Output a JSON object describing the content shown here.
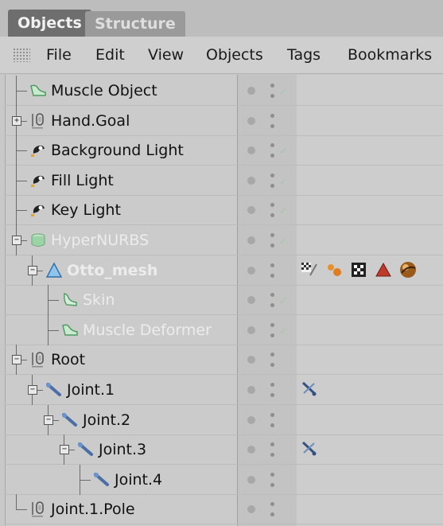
{
  "tabs": [
    {
      "label": "Objects"
    },
    {
      "label": "Structure"
    }
  ],
  "menu": [
    "File",
    "Edit",
    "View",
    "Objects",
    "Tags",
    "Bookmarks"
  ],
  "rows": [
    {
      "label": "Muscle Object",
      "icon": "muscle-object-icon",
      "depth": 0,
      "expander": null,
      "dim": false,
      "bold": false,
      "check": true,
      "tags": []
    },
    {
      "label": "Hand.Goal",
      "icon": "null-object-icon",
      "depth": 0,
      "expander": "+",
      "dim": false,
      "bold": false,
      "check": false,
      "tags": []
    },
    {
      "label": "Background Light",
      "icon": "light-icon",
      "depth": 0,
      "expander": null,
      "dim": false,
      "bold": false,
      "check": true,
      "tags": []
    },
    {
      "label": "Fill Light",
      "icon": "light-icon",
      "depth": 0,
      "expander": null,
      "dim": false,
      "bold": false,
      "check": true,
      "tags": []
    },
    {
      "label": "Key Light",
      "icon": "light-icon",
      "depth": 0,
      "expander": null,
      "dim": false,
      "bold": false,
      "check": true,
      "tags": []
    },
    {
      "label": "HyperNURBS",
      "icon": "hypernurbs-icon",
      "depth": 0,
      "expander": "-",
      "dim": true,
      "bold": false,
      "check": true,
      "tags": []
    },
    {
      "label": "Otto_mesh",
      "icon": "polygon-mesh-icon",
      "depth": 1,
      "expander": "-",
      "dim": true,
      "bold": true,
      "check": false,
      "tags": [
        "uvw-tag-icon",
        "material-tag-icon",
        "checker-tag-icon",
        "phong-tag-icon",
        "sphere-material-icon"
      ]
    },
    {
      "label": "Skin",
      "icon": "skin-deformer-icon",
      "depth": 2,
      "expander": null,
      "dim": true,
      "bold": false,
      "check": true,
      "tags": []
    },
    {
      "label": "Muscle Deformer",
      "icon": "muscle-deformer-icon",
      "depth": 2,
      "expander": null,
      "dim": true,
      "bold": false,
      "check": true,
      "tags": []
    },
    {
      "label": "Root",
      "icon": "null-object-icon",
      "depth": 0,
      "expander": "-",
      "dim": false,
      "bold": false,
      "check": false,
      "tags": []
    },
    {
      "label": "Joint.1",
      "icon": "joint-icon",
      "depth": 1,
      "expander": "-",
      "dim": false,
      "bold": false,
      "check": false,
      "tags": [
        "ik-tag-icon"
      ]
    },
    {
      "label": "Joint.2",
      "icon": "joint-icon",
      "depth": 2,
      "expander": "-",
      "dim": false,
      "bold": false,
      "check": false,
      "tags": []
    },
    {
      "label": "Joint.3",
      "icon": "joint-icon",
      "depth": 3,
      "expander": "-",
      "dim": false,
      "bold": false,
      "check": false,
      "tags": [
        "ik-tag-icon"
      ]
    },
    {
      "label": "Joint.4",
      "icon": "joint-icon",
      "depth": 4,
      "expander": null,
      "dim": false,
      "bold": false,
      "check": false,
      "tags": []
    },
    {
      "label": "Joint.1.Pole",
      "icon": "null-object-icon",
      "depth": 0,
      "expander": null,
      "dim": false,
      "bold": false,
      "check": false,
      "tags": []
    }
  ]
}
